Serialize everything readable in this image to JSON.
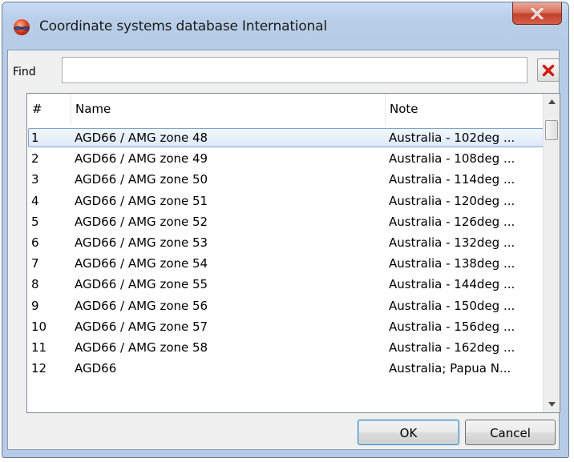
{
  "window": {
    "title": "Coordinate systems database International",
    "close_icon": "close-icon"
  },
  "find": {
    "label": "Find",
    "value": "",
    "placeholder": "",
    "clear_icon": "red-x-icon"
  },
  "table": {
    "columns": [
      "#",
      "Name",
      "Note"
    ],
    "selected_row": 0,
    "rows": [
      [
        "1",
        "AGD66 / AMG zone 48",
        "Australia - 102deg ..."
      ],
      [
        "2",
        "AGD66 / AMG zone 49",
        "Australia - 108deg ..."
      ],
      [
        "3",
        "AGD66 / AMG zone 50",
        "Australia - 114deg ..."
      ],
      [
        "4",
        "AGD66 / AMG zone 51",
        "Australia - 120deg ..."
      ],
      [
        "5",
        "AGD66 / AMG zone 52",
        "Australia - 126deg ..."
      ],
      [
        "6",
        "AGD66 / AMG zone 53",
        "Australia - 132deg ..."
      ],
      [
        "7",
        "AGD66 / AMG zone 54",
        "Australia - 138deg ..."
      ],
      [
        "8",
        "AGD66 / AMG zone 55",
        "Australia - 144deg ..."
      ],
      [
        "9",
        "AGD66 / AMG zone 56",
        "Australia - 150deg ..."
      ],
      [
        "10",
        "AGD66 / AMG zone 57",
        "Australia - 156deg ..."
      ],
      [
        "11",
        "AGD66 / AMG zone 58",
        "Australia - 162deg ..."
      ],
      [
        "12",
        "AGD66",
        "Australia; Papua N..."
      ]
    ]
  },
  "buttons": {
    "ok": "OK",
    "cancel": "Cancel"
  },
  "colors": {
    "selection_border": "#7da2ce",
    "selection_fill": "#dce9f8",
    "close_red": "#c2402b"
  }
}
